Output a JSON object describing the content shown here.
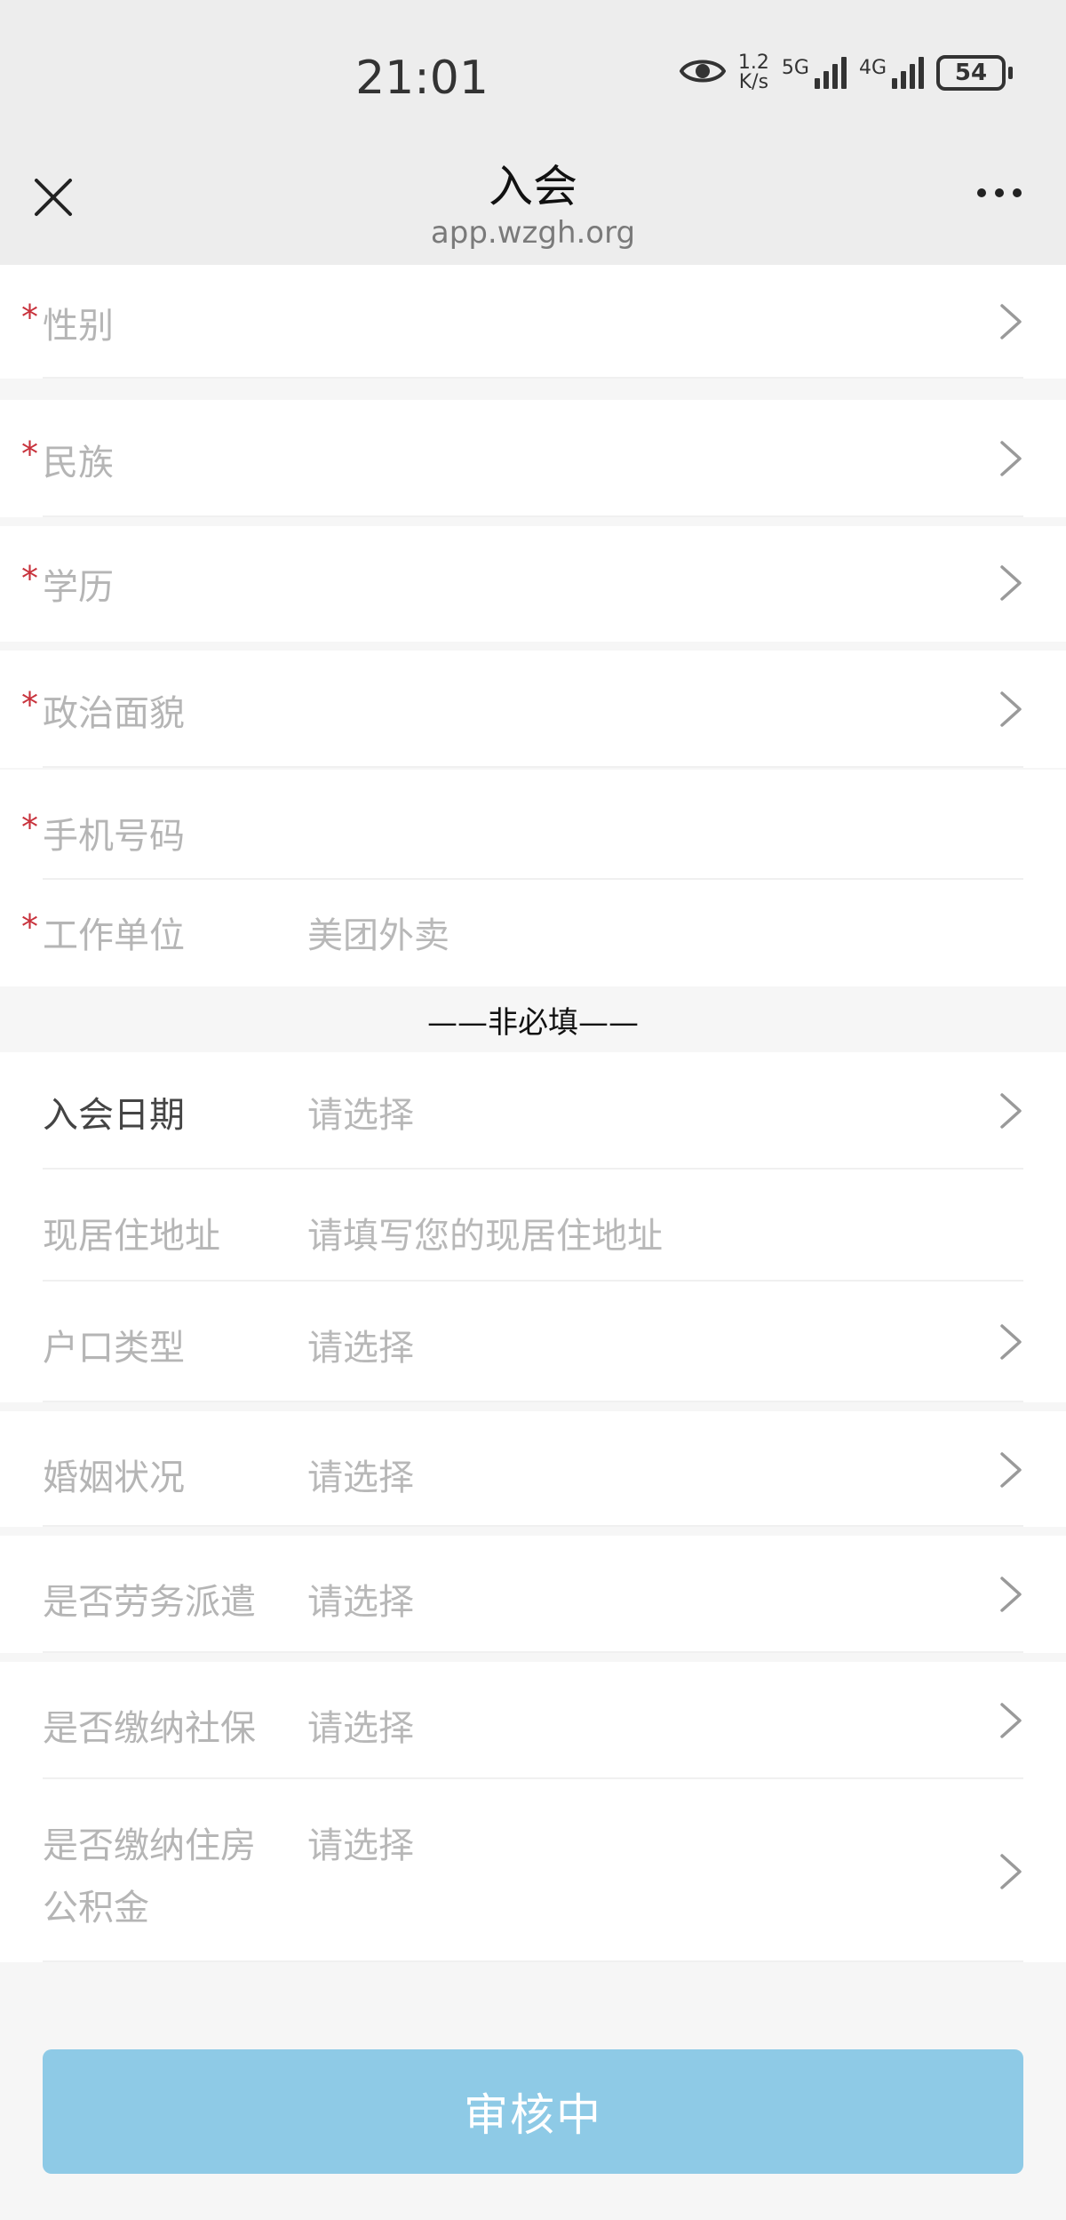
{
  "status_bar": {
    "time": "21:01",
    "net_speed_value": "1.2",
    "net_speed_unit": "K/s",
    "signal1_label": "5G",
    "signal2_label": "4G",
    "battery": "54",
    "icons": [
      "eye-icon",
      "signal-5g-icon",
      "signal-4g-icon",
      "battery-icon"
    ]
  },
  "nav": {
    "title": "入会",
    "subtitle": "app.wzgh.org",
    "icons": [
      "close-icon",
      "more-icon"
    ]
  },
  "required_fields": [
    {
      "label": "性别",
      "value": "",
      "has_chevron": true
    },
    {
      "label": "民族",
      "value": "",
      "has_chevron": true
    },
    {
      "label": "学历",
      "value": "",
      "has_chevron": true
    },
    {
      "label": "政治面貌",
      "value": "",
      "has_chevron": true
    },
    {
      "label": "手机号码",
      "value": "",
      "has_chevron": false
    },
    {
      "label": "工作单位",
      "value": "美团外卖",
      "has_chevron": false
    }
  ],
  "required_marker": "*",
  "optional_section_title": "——非必填——",
  "optional_fields": [
    {
      "label": "入会日期",
      "value": "请选择",
      "has_chevron": true
    },
    {
      "label": "现居住地址",
      "value": "请填写您的现居住地址",
      "has_chevron": false
    },
    {
      "label": "户口类型",
      "value": "请选择",
      "has_chevron": true
    },
    {
      "label": "婚姻状况",
      "value": "请选择",
      "has_chevron": true
    },
    {
      "label": "是否劳务派遣",
      "value": "请选择",
      "has_chevron": true
    },
    {
      "label": "是否缴纳社保",
      "value": "请选择",
      "has_chevron": true
    },
    {
      "label": "是否缴纳住房",
      "label_line2": "公积金",
      "value": "请选择",
      "has_chevron": true
    }
  ],
  "submit_button": {
    "label": "审核中",
    "color": "#8ecae6"
  },
  "colors": {
    "required_marker": "#c8323c",
    "label_muted": "#b5b5b5",
    "header_bg": "#ededed",
    "page_bg": "#f6f6f6"
  }
}
